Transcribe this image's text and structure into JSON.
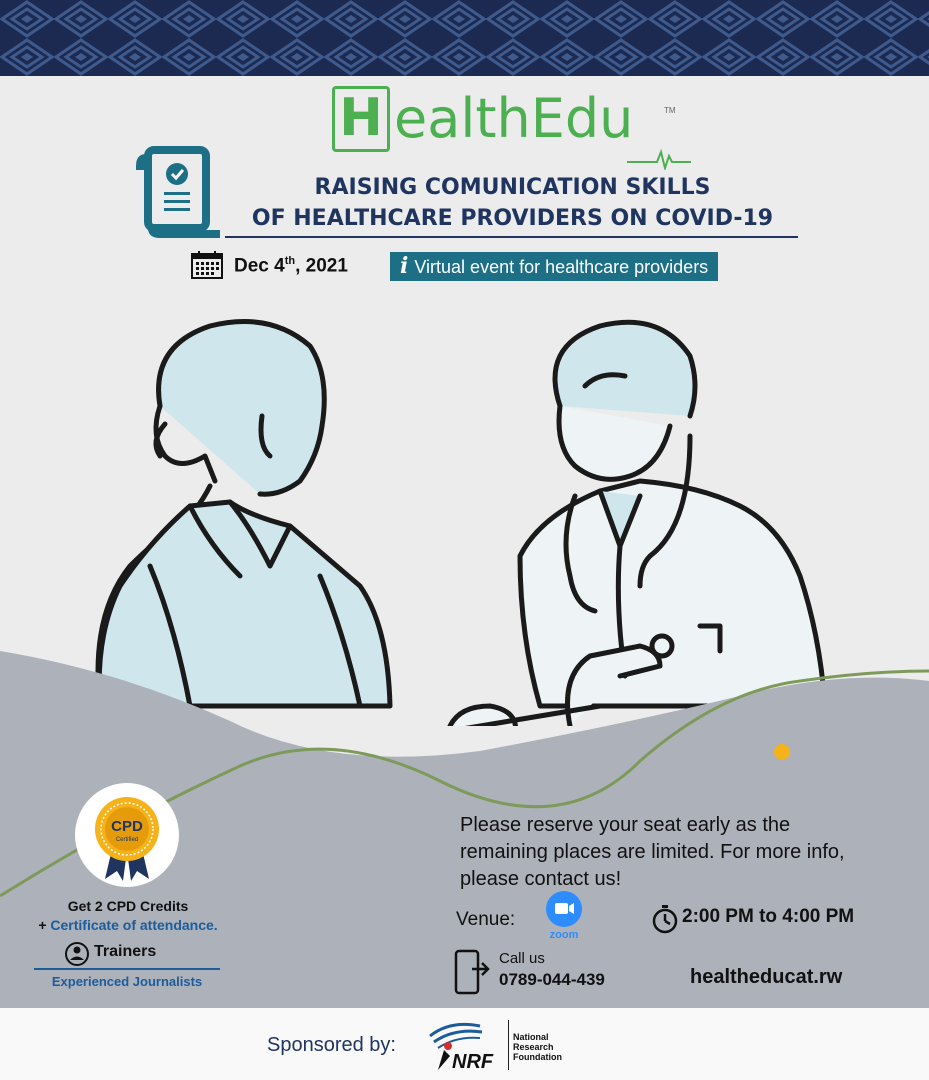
{
  "brand": {
    "logo_letter": "H",
    "logo_rest": "ealthEdu",
    "trademark": "TM"
  },
  "title": {
    "line1": "RAISING COMUNICATION SKILLS",
    "line2": "OF HEALTHCARE PROVIDERS ON COVID-19"
  },
  "event": {
    "date_main": "Dec 4",
    "date_sup": "th",
    "date_year": ", 2021",
    "format_icon": "i",
    "format_label": "Virtual event for healthcare providers"
  },
  "cpd": {
    "badge_title": "CPD",
    "badge_sub": "Certified",
    "credits": "Get 2 CPD Credits",
    "plus": "+ ",
    "certificate": "Certificate of attendance."
  },
  "trainers": {
    "label": "Trainers",
    "value": "Experienced Journalists"
  },
  "reserve_text": "Please reserve your seat early as the remaining places are limited. For more info, please contact us!",
  "venue": {
    "label": "Venue:",
    "platform": "zoom"
  },
  "time": "2:00 PM to 4:00 PM",
  "contact": {
    "call_label": "Call us",
    "phone": "0789-044-439",
    "website": "healtheducat.rw"
  },
  "sponsor": {
    "label": "Sponsored by:",
    "logo_abbr": "NRF",
    "name_line1": "National",
    "name_line2": "Research",
    "name_line3": "Foundation"
  },
  "colors": {
    "brand_green": "#4caf50",
    "navy": "#1f3560",
    "teal": "#1d6f86",
    "link_blue": "#1d5c9a",
    "zoom_blue": "#2d8cff",
    "pattern_bg": "#1c2a52",
    "accent_yellow": "#f6b21b"
  },
  "icons": [
    "document-check-icon",
    "calendar-icon",
    "info-icon",
    "cpd-badge-icon",
    "trainer-icon",
    "zoom-icon",
    "stopwatch-icon",
    "phone-icon",
    "nrf-logo"
  ]
}
